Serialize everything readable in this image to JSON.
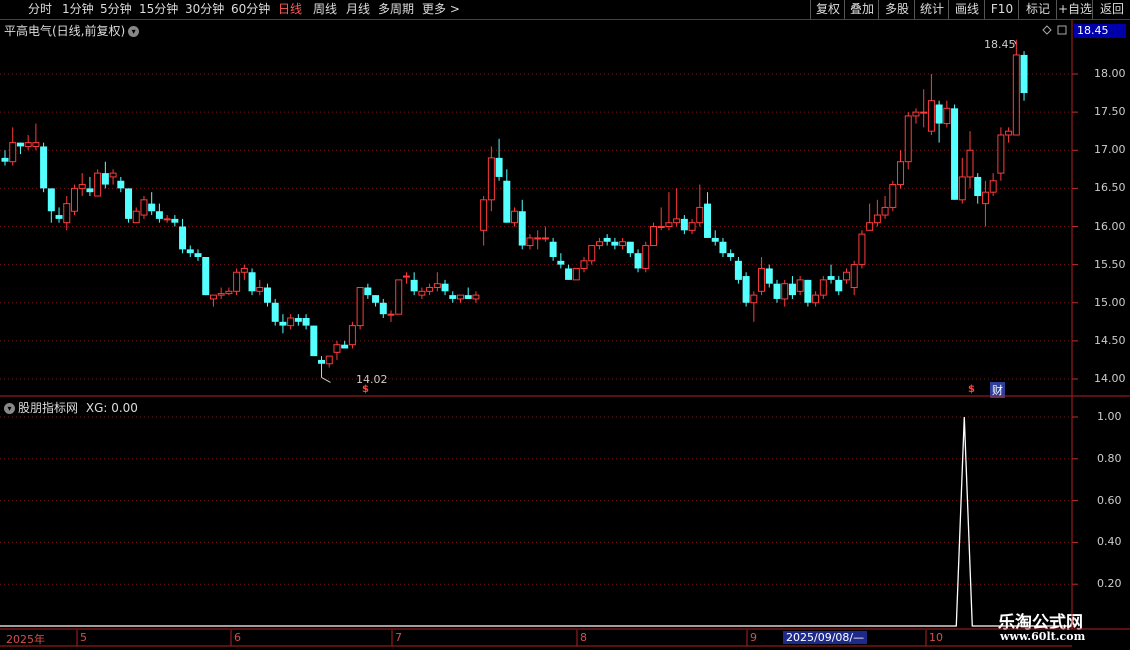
{
  "toolbar": {
    "periods": [
      "分时",
      "1分钟",
      "5分钟",
      "15分钟",
      "30分钟",
      "60分钟",
      "日线",
      "周线",
      "月线",
      "多周期",
      "更多 >"
    ],
    "active_period": "日线",
    "right_buttons": [
      "复权",
      "叠加",
      "多股",
      "统计",
      "画线",
      "F10",
      "标记",
      "+自选",
      "返回"
    ]
  },
  "main_chart": {
    "title": "平高电气(日线,前复权)",
    "current_price": "18.45",
    "high_label": "18.45",
    "low_label": "14.02",
    "axis_ticks": [
      "18.00",
      "17.50",
      "17.00",
      "16.50",
      "16.00",
      "15.50",
      "15.00",
      "14.50",
      "14.00"
    ],
    "markers": {
      "s1": "$",
      "s2": "$",
      "cai": "财"
    },
    "colors": {
      "up": "#ff3b3b",
      "down": "#54ffff",
      "grid": "#8b1a1a"
    }
  },
  "indicator": {
    "title": "股朋指标网",
    "value_label": "XG: 0.00",
    "axis_ticks": [
      "1.00",
      "0.80",
      "0.60",
      "0.40",
      "0.20"
    ]
  },
  "dates": {
    "year": "2025年",
    "months": [
      "5",
      "6",
      "7",
      "8",
      "9",
      "10"
    ],
    "cursor": "2025/09/08/—"
  },
  "watermark": {
    "line1": "乐淘公式网",
    "line2": "www.60lt.com"
  },
  "chart_data": [
    {
      "type": "candlestick",
      "title": "平高电气(日线,前复权)",
      "ylim": [
        13.9,
        18.5
      ],
      "ticks": [
        14.0,
        14.5,
        15.0,
        15.5,
        16.0,
        16.5,
        17.0,
        17.5,
        18.0
      ],
      "ohlc": [
        [
          16.9,
          17.0,
          16.8,
          16.85
        ],
        [
          16.85,
          17.3,
          16.8,
          17.1
        ],
        [
          17.1,
          17.1,
          16.95,
          17.05
        ],
        [
          17.05,
          17.2,
          17.0,
          17.1
        ],
        [
          17.05,
          17.35,
          17.0,
          17.1
        ],
        [
          17.05,
          17.1,
          16.45,
          16.5
        ],
        [
          16.5,
          16.5,
          16.05,
          16.2
        ],
        [
          16.15,
          16.25,
          16.05,
          16.1
        ],
        [
          16.05,
          16.4,
          15.95,
          16.3
        ],
        [
          16.2,
          16.55,
          16.15,
          16.5
        ],
        [
          16.5,
          16.7,
          16.4,
          16.55
        ],
        [
          16.5,
          16.65,
          16.4,
          16.45
        ],
        [
          16.4,
          16.75,
          16.4,
          16.7
        ],
        [
          16.7,
          16.85,
          16.5,
          16.55
        ],
        [
          16.65,
          16.75,
          16.55,
          16.7
        ],
        [
          16.6,
          16.65,
          16.45,
          16.5
        ],
        [
          16.5,
          16.5,
          16.05,
          16.1
        ],
        [
          16.05,
          16.25,
          16.05,
          16.2
        ],
        [
          16.15,
          16.4,
          16.1,
          16.35
        ],
        [
          16.3,
          16.45,
          16.15,
          16.2
        ],
        [
          16.2,
          16.3,
          16.05,
          16.1
        ],
        [
          16.1,
          16.15,
          16.05,
          16.1
        ],
        [
          16.1,
          16.15,
          16.0,
          16.05
        ],
        [
          16.0,
          16.1,
          15.65,
          15.7
        ],
        [
          15.7,
          15.75,
          15.6,
          15.65
        ],
        [
          15.65,
          15.7,
          15.55,
          15.6
        ],
        [
          15.6,
          15.6,
          15.1,
          15.1
        ],
        [
          15.05,
          15.1,
          14.95,
          15.1
        ],
        [
          15.1,
          15.2,
          15.05,
          15.12
        ],
        [
          15.12,
          15.2,
          15.1,
          15.15
        ],
        [
          15.15,
          15.45,
          15.1,
          15.4
        ],
        [
          15.4,
          15.5,
          15.3,
          15.45
        ],
        [
          15.4,
          15.45,
          15.1,
          15.15
        ],
        [
          15.15,
          15.3,
          15.1,
          15.2
        ],
        [
          15.2,
          15.25,
          14.95,
          15.0
        ],
        [
          15.0,
          15.05,
          14.7,
          14.75
        ],
        [
          14.75,
          14.85,
          14.6,
          14.7
        ],
        [
          14.7,
          14.85,
          14.65,
          14.8
        ],
        [
          14.8,
          14.85,
          14.7,
          14.75
        ],
        [
          14.8,
          14.85,
          14.65,
          14.7
        ],
        [
          14.7,
          14.7,
          14.3,
          14.3
        ],
        [
          14.25,
          14.3,
          14.02,
          14.2
        ],
        [
          14.2,
          14.3,
          14.15,
          14.3
        ],
        [
          14.35,
          14.5,
          14.25,
          14.45
        ],
        [
          14.45,
          14.5,
          14.4,
          14.4
        ],
        [
          14.45,
          14.75,
          14.4,
          14.7
        ],
        [
          14.7,
          15.2,
          14.65,
          15.2
        ],
        [
          15.2,
          15.25,
          15.05,
          15.1
        ],
        [
          15.1,
          15.1,
          14.95,
          15.0
        ],
        [
          15.0,
          15.05,
          14.8,
          14.85
        ],
        [
          14.85,
          14.9,
          14.75,
          14.85
        ],
        [
          14.85,
          15.3,
          14.85,
          15.3
        ],
        [
          15.35,
          15.4,
          15.25,
          15.35
        ],
        [
          15.3,
          15.4,
          15.1,
          15.15
        ],
        [
          15.1,
          15.2,
          15.05,
          15.15
        ],
        [
          15.15,
          15.25,
          15.1,
          15.2
        ],
        [
          15.2,
          15.4,
          15.15,
          15.25
        ],
        [
          15.25,
          15.3,
          15.1,
          15.15
        ],
        [
          15.1,
          15.15,
          15.0,
          15.05
        ],
        [
          15.05,
          15.1,
          15.0,
          15.1
        ],
        [
          15.1,
          15.2,
          15.05,
          15.05
        ],
        [
          15.05,
          15.15,
          15.0,
          15.1
        ],
        [
          15.95,
          16.4,
          15.75,
          16.35
        ],
        [
          16.35,
          17.05,
          16.2,
          16.9
        ],
        [
          16.9,
          17.15,
          16.6,
          16.65
        ],
        [
          16.6,
          16.75,
          16.05,
          16.05
        ],
        [
          16.05,
          16.25,
          16.0,
          16.2
        ],
        [
          16.2,
          16.35,
          15.7,
          15.75
        ],
        [
          15.75,
          15.9,
          15.7,
          15.85
        ],
        [
          15.85,
          15.95,
          15.7,
          15.85
        ],
        [
          15.85,
          16.0,
          15.8,
          15.85
        ],
        [
          15.8,
          15.85,
          15.55,
          15.6
        ],
        [
          15.55,
          15.65,
          15.45,
          15.5
        ],
        [
          15.45,
          15.5,
          15.3,
          15.3
        ],
        [
          15.3,
          15.45,
          15.3,
          15.45
        ],
        [
          15.45,
          15.6,
          15.4,
          15.55
        ],
        [
          15.55,
          15.75,
          15.5,
          15.75
        ],
        [
          15.75,
          15.85,
          15.7,
          15.8
        ],
        [
          15.85,
          15.9,
          15.75,
          15.8
        ],
        [
          15.8,
          15.85,
          15.7,
          15.75
        ],
        [
          15.75,
          15.85,
          15.7,
          15.8
        ],
        [
          15.8,
          15.8,
          15.6,
          15.65
        ],
        [
          15.65,
          15.7,
          15.4,
          15.45
        ],
        [
          15.45,
          15.8,
          15.4,
          15.75
        ],
        [
          15.75,
          16.05,
          15.75,
          16.0
        ],
        [
          16.0,
          16.25,
          15.95,
          16.0
        ],
        [
          16.0,
          16.45,
          15.95,
          16.05
        ],
        [
          16.05,
          16.5,
          16.0,
          16.1
        ],
        [
          16.1,
          16.15,
          15.9,
          15.95
        ],
        [
          15.95,
          16.1,
          15.9,
          16.05
        ],
        [
          16.05,
          16.55,
          16.0,
          16.25
        ],
        [
          16.3,
          16.45,
          15.85,
          15.85
        ],
        [
          15.85,
          15.95,
          15.75,
          15.8
        ],
        [
          15.8,
          15.85,
          15.6,
          15.65
        ],
        [
          15.65,
          15.7,
          15.55,
          15.6
        ],
        [
          15.55,
          15.6,
          15.25,
          15.3
        ],
        [
          15.35,
          15.4,
          14.95,
          15.0
        ],
        [
          15.0,
          15.15,
          14.75,
          15.1
        ],
        [
          15.15,
          15.6,
          15.1,
          15.45
        ],
        [
          15.45,
          15.5,
          15.2,
          15.25
        ],
        [
          15.25,
          15.3,
          15.0,
          15.05
        ],
        [
          15.05,
          15.3,
          14.95,
          15.25
        ],
        [
          15.25,
          15.35,
          15.05,
          15.1
        ],
        [
          15.15,
          15.35,
          15.1,
          15.3
        ],
        [
          15.3,
          15.3,
          14.95,
          15.0
        ],
        [
          15.0,
          15.15,
          14.95,
          15.1
        ],
        [
          15.1,
          15.35,
          15.05,
          15.3
        ],
        [
          15.35,
          15.5,
          15.25,
          15.3
        ],
        [
          15.3,
          15.35,
          15.1,
          15.15
        ],
        [
          15.3,
          15.45,
          15.25,
          15.4
        ],
        [
          15.2,
          15.55,
          15.1,
          15.5
        ],
        [
          15.5,
          15.95,
          15.45,
          15.9
        ],
        [
          15.95,
          16.3,
          15.95,
          16.05
        ],
        [
          16.05,
          16.35,
          16.0,
          16.15
        ],
        [
          16.15,
          16.4,
          16.1,
          16.25
        ],
        [
          16.25,
          16.6,
          16.2,
          16.55
        ],
        [
          16.55,
          17.0,
          16.5,
          16.85
        ],
        [
          16.85,
          17.5,
          16.75,
          17.45
        ],
        [
          17.45,
          17.55,
          17.35,
          17.5
        ],
        [
          17.5,
          17.8,
          17.3,
          17.5
        ],
        [
          17.25,
          18.0,
          17.2,
          17.65
        ],
        [
          17.6,
          17.65,
          17.1,
          17.35
        ],
        [
          17.35,
          17.65,
          17.3,
          17.55
        ],
        [
          17.55,
          17.6,
          16.35,
          16.35
        ],
        [
          16.35,
          16.9,
          16.3,
          16.65
        ],
        [
          16.65,
          17.25,
          16.5,
          17.0
        ],
        [
          16.65,
          16.7,
          16.3,
          16.4
        ],
        [
          16.3,
          16.6,
          16.0,
          16.45
        ],
        [
          16.45,
          16.7,
          16.4,
          16.6
        ],
        [
          16.7,
          17.3,
          16.6,
          17.2
        ],
        [
          17.2,
          17.3,
          17.1,
          17.25
        ],
        [
          17.2,
          18.45,
          17.2,
          18.25
        ],
        [
          18.25,
          18.3,
          17.65,
          17.75
        ]
      ],
      "month_markers": [
        "5",
        "6",
        "7",
        "8",
        "9",
        "10"
      ]
    },
    {
      "type": "line",
      "title": "股朋指标网",
      "series_label": "XG",
      "ylim": [
        0,
        1.05
      ],
      "ticks": [
        0.2,
        0.4,
        0.6,
        0.8,
        1.0
      ],
      "spike": {
        "value": 1.0,
        "at_candle": 124
      },
      "last_value": 0.0
    }
  ]
}
